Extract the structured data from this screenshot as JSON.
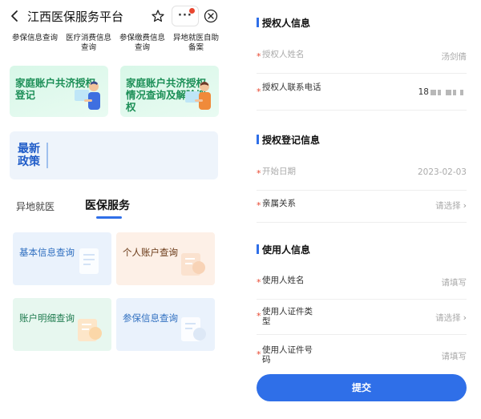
{
  "nav": {
    "title": "江西医保服务平台",
    "more_label": "···"
  },
  "quick_links": [
    "参保信息查询",
    "医疗消费信息\n查询",
    "参保缴费信息\n查询",
    "异地就医自助\n备案"
  ],
  "cards": [
    {
      "text": "家庭账户共济授权登记"
    },
    {
      "text": "家庭账户共济授权情况查询及解除授权"
    }
  ],
  "policy": {
    "badge": "最新政策"
  },
  "tabs": {
    "tab1": "异地就医",
    "tab2": "医保服务"
  },
  "grid": [
    {
      "label": "基本信息查询"
    },
    {
      "label": "个人账户查询"
    },
    {
      "label": "账户明细查询"
    },
    {
      "label": "参保信息查询"
    }
  ],
  "form": {
    "section1": "授权人信息",
    "auth_name_label": "授权人姓名",
    "auth_name_value": "汤剑倩",
    "auth_phone_label": "授权人联系电话",
    "auth_phone_prefix": "18",
    "section2": "授权登记信息",
    "start_date_label": "开始日期",
    "start_date_value": "2023-02-03",
    "relation_label": "亲属关系",
    "relation_value": "请选择",
    "section3": "使用人信息",
    "user_name_label": "使用人姓名",
    "user_name_value": "请填写",
    "user_idtype_label": "使用人证件类型",
    "user_idtype_value": "请选择",
    "user_idno_label": "使用人证件号码",
    "user_idno_value": "请填写",
    "submit_label": "提交"
  },
  "colors": {
    "primary": "#2f6fe8",
    "green": "#1c8f57",
    "required": "#e8462f"
  }
}
